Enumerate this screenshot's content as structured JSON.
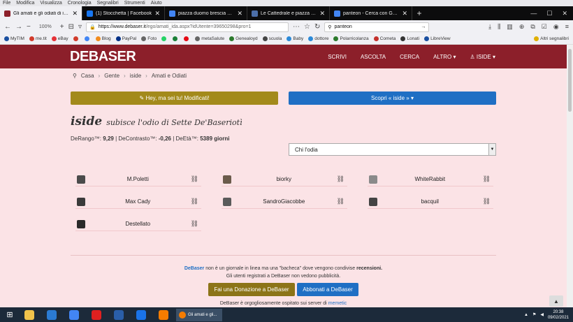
{
  "menubar": [
    "File",
    "Modifica",
    "Visualizza",
    "Cronologia",
    "Segnalibri",
    "Strumenti",
    "Aiuto"
  ],
  "tabs": [
    {
      "title": "Gli amati e gli odiati di iside",
      "color": "#8c1f2a",
      "active": true
    },
    {
      "title": "(1) Stocchetta | Facebook",
      "color": "#1877f2",
      "active": false
    },
    {
      "title": "piazza duomo brescia cartolin",
      "color": "#4285f4",
      "active": false
    },
    {
      "title": "Le Cattedrale e piazza Duomo",
      "color": "#4c6ea8",
      "active": false
    },
    {
      "title": "panteon - Cerca con Google",
      "color": "#4285f4",
      "active": false
    }
  ],
  "nav": {
    "zoom": "100%",
    "url_host": "https://www.debaser.it",
    "url_path": "/ego/amati_ida.aspx?idUtente=39650298&pro=1",
    "search": "panteon"
  },
  "bookmarks": [
    {
      "label": "MyTIM",
      "color": "#1a4fa0"
    },
    {
      "label": "me.tit",
      "color": "#d13b2b"
    },
    {
      "label": "eBay",
      "color": "#e53238"
    },
    {
      "label": "",
      "color": "#d13b2b"
    },
    {
      "label": "",
      "color": "#4285f4"
    },
    {
      "label": "Blog",
      "color": "#f28c1c"
    },
    {
      "label": "PayPal",
      "color": "#003087"
    },
    {
      "label": "Foto",
      "color": "#666666"
    },
    {
      "label": "",
      "color": "#25d366"
    },
    {
      "label": "",
      "color": "#1a7f37"
    },
    {
      "label": "",
      "color": "#e50914"
    },
    {
      "label": "metaSalute",
      "color": "#666666"
    },
    {
      "label": "Genealoyd",
      "color": "#2c7a2c"
    },
    {
      "label": "scuola",
      "color": "#444444"
    },
    {
      "label": "Baby",
      "color": "#2c8ad8"
    },
    {
      "label": "dottore",
      "color": "#2c8ad8"
    },
    {
      "label": "Polarricolanza",
      "color": "#2c7a2c"
    },
    {
      "label": "Cometa",
      "color": "#c4302b"
    },
    {
      "label": "Lonati",
      "color": "#333333"
    },
    {
      "label": "LibreView",
      "color": "#1a4fa0"
    },
    {
      "label": "Altri segnalibri",
      "color": "#e0b000"
    }
  ],
  "site": {
    "logo": "DEBASER",
    "nav": [
      "SCRIVI",
      "ASCOLTA",
      "CERCA",
      "ALTRO ▾",
      "♙ ISIDE ▾"
    ]
  },
  "breadcrumb": [
    "Casa",
    "Gente",
    "iside",
    "Amati e Odiati"
  ],
  "buttons": {
    "edit": "✎ Hey, ma sei tu! Modificati!",
    "discover": "Scopri « iside » ▾"
  },
  "heading": {
    "nick": "iside",
    "subtitle": "subisce l'odio di Sette De'Baseriotì"
  },
  "stats": {
    "rango_label": "DeRango™:",
    "rango": "9,29",
    "contrasto_label": "DeContrasto™:",
    "contrasto": "-0,26",
    "eta_label": "DeEtà™:",
    "eta": "5389 giorni"
  },
  "filter": {
    "selected": "Chi l'odia"
  },
  "users": [
    {
      "name": "M.Poletti",
      "avatar": "#4b4b4b"
    },
    {
      "name": "biorky",
      "avatar": "#6b5b4b"
    },
    {
      "name": "WhiteRabbit",
      "avatar": "#8a8a8a"
    },
    {
      "name": "Max Cady",
      "avatar": "#3a3a3a"
    },
    {
      "name": "SandroGiacobbe",
      "avatar": "#5a5a5a"
    },
    {
      "name": "bacquil",
      "avatar": "#444444"
    },
    {
      "name": "Destellato",
      "avatar": "#2a2a2a"
    }
  ],
  "footer": {
    "brand": "DeBaser",
    "line1_a": "non è un giornale in linea ma una \"bacheca\" dove vengono condivise",
    "line1_b": "recensioni.",
    "line2": "Gli utenti registrati a DeBaser non vedono pubblicità.",
    "donate": "Fai una Donazione a DeBaser",
    "subscribe": "Abbonati a DeBaser",
    "hosted_a": "DeBaser è orgogliosamente ospitato sui server di",
    "hosted_b": "memetic"
  },
  "taskbar": {
    "apps": [
      "#f0c24b",
      "#2b7bd3",
      "#4285f4",
      "#e02020",
      "#2a5ea8",
      "#1a73e8",
      "#f57c00"
    ],
    "task_title": "Gli amati e gli...",
    "time": "20:38",
    "date": "09/02/2021"
  }
}
